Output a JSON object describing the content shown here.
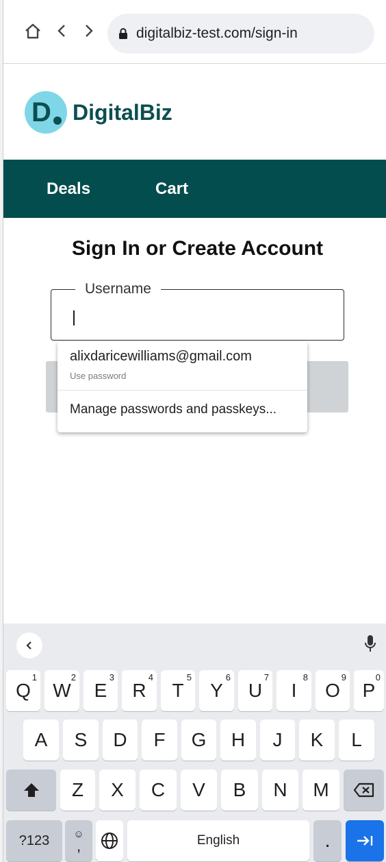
{
  "browser": {
    "url": "digitalbiz-test.com/sign-in",
    "home_icon": "home-icon",
    "back_icon": "chevron-left-icon",
    "forward_icon": "chevron-right-icon",
    "lock_icon": "lock-icon"
  },
  "site": {
    "logo_mark": "D",
    "logo_text": "DigitalBiz",
    "brand_color": "#044d4e",
    "logo_circle_color": "#7fd6e6",
    "nav": [
      {
        "label": "Deals"
      },
      {
        "label": "Cart"
      }
    ]
  },
  "page": {
    "title": "Sign In or Create Account",
    "username_label": "Username",
    "username_value": ""
  },
  "autofill": {
    "email": "alixdaricewilliams@gmail.com",
    "sub": "Use password",
    "manage": "Manage passwords and passkeys..."
  },
  "keyboard": {
    "row1": [
      {
        "key": "Q",
        "hint": "1"
      },
      {
        "key": "W",
        "hint": "2"
      },
      {
        "key": "E",
        "hint": "3"
      },
      {
        "key": "R",
        "hint": "4"
      },
      {
        "key": "T",
        "hint": "5"
      },
      {
        "key": "Y",
        "hint": "6"
      },
      {
        "key": "U",
        "hint": "7"
      },
      {
        "key": "I",
        "hint": "8"
      },
      {
        "key": "O",
        "hint": "9"
      },
      {
        "key": "P",
        "hint": "0"
      }
    ],
    "row2": [
      "A",
      "S",
      "D",
      "F",
      "G",
      "H",
      "J",
      "K",
      "L"
    ],
    "row3": [
      "Z",
      "X",
      "C",
      "V",
      "B",
      "N",
      "M"
    ],
    "symbols_label": "?123",
    "emoji_comma_label": ",",
    "space_label": "English",
    "period_label": ".",
    "accent_color": "#1a73e8"
  }
}
